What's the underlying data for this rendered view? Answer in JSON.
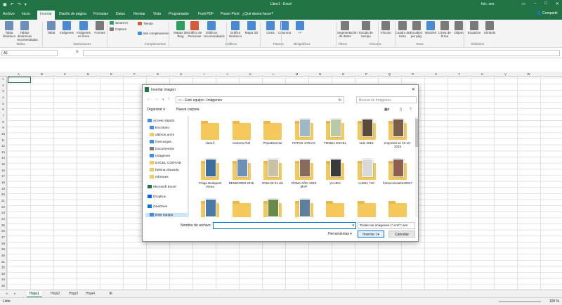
{
  "window": {
    "title": "Libro1  -  Excel",
    "user": "Inic. ses.",
    "share": "Compartir"
  },
  "quickaccess": [
    "save-icon",
    "undo-icon",
    "redo-icon",
    "customize-icon"
  ],
  "tabs": [
    "Archivo",
    "Inicio",
    "Insertar",
    "Diseño de página",
    "Fórmulas",
    "Datos",
    "Revisar",
    "Vista",
    "Programador",
    "Foxit PDF",
    "Power Pivot",
    "¿Qué desea hacer?"
  ],
  "ribbon": {
    "buttons": [
      {
        "label": "Tabla dinámica",
        "color": "#6b8fb8"
      },
      {
        "label": "Tablas dinámicas recomendadas",
        "color": "#6b8fb8"
      },
      {
        "label": "Tabla",
        "color": "#6b8fb8"
      },
      {
        "label": "Imágenes",
        "color": "#4a8ad4"
      },
      {
        "label": "Imágenes en línea",
        "color": "#4a8ad4"
      },
      {
        "label": "Formas",
        "color": "#7a7a7a"
      },
      {
        "label": "Mapas de Bing",
        "color": "#2e9e5b"
      },
      {
        "label": "Gráfico de Personas",
        "color": "#d65b3a"
      },
      {
        "label": "Gráficos recomendados",
        "color": "#4a8ad4"
      },
      {
        "label": "Gráfico dinámico",
        "color": "#4a8ad4"
      },
      {
        "label": "Mapa 3D",
        "color": "#4a8ad4"
      },
      {
        "label": "Línea",
        "color": "#4a8ad4"
      },
      {
        "label": "Columna",
        "color": "#4a8ad4"
      },
      {
        "label": "+/-",
        "color": "#4a8ad4"
      },
      {
        "label": "Segmentación de datos",
        "color": "#7a7a7a"
      },
      {
        "label": "Escala de tiempo",
        "color": "#7a7a7a"
      },
      {
        "label": "Vínculo",
        "color": "#7a7a7a"
      },
      {
        "label": "Cuadro de texto",
        "color": "#7a7a7a"
      },
      {
        "label": "Encabez. pie pág.",
        "color": "#7a7a7a"
      },
      {
        "label": "WordArt",
        "color": "#4a8ad4"
      },
      {
        "label": "Línea de firma",
        "color": "#7a7a7a"
      },
      {
        "label": "Objeto",
        "color": "#7a7a7a"
      },
      {
        "label": "Ecuación",
        "color": "#7a7a7a"
      },
      {
        "label": "Símbolo",
        "color": "#7a7a7a"
      }
    ],
    "small": [
      "SmartArt",
      "Captura",
      "Tienda",
      "Mis complementos"
    ],
    "groups": [
      "Tablas",
      "Ilustraciones",
      "Complementos",
      "Gráficos",
      "Paseos",
      "Minigráficos",
      "Filtros",
      "Vínculos",
      "Texto",
      "Símbolos"
    ]
  },
  "formula": {
    "namebox": "A1",
    "fx": "fx"
  },
  "columns": [
    "A",
    "B",
    "C",
    "D",
    "E",
    "F",
    "G",
    "H",
    "I",
    "J",
    "K",
    "L",
    "M",
    "N",
    "O",
    "P",
    "Q",
    "R",
    "S",
    "T",
    "U",
    "V",
    "W"
  ],
  "rows": [
    "1",
    "2",
    "3",
    "4",
    "5",
    "6",
    "7",
    "8",
    "9",
    "10",
    "11",
    "12",
    "13",
    "14",
    "15",
    "16",
    "17",
    "18",
    "19",
    "20",
    "21",
    "22",
    "23",
    "24",
    "25",
    "26",
    "27",
    "28",
    "29",
    "30",
    "31",
    "32",
    "33",
    "34",
    "35"
  ],
  "sheets": [
    "Hoja1",
    "Hoja2",
    "Hoja3",
    "Hoja4"
  ],
  "status": {
    "left": "Listo",
    "zoom": "100 %"
  },
  "dialog": {
    "title": "Insertar imagen",
    "path": [
      "Este equipo",
      "Imágenes"
    ],
    "search_placeholder": "Buscar en Imágenes",
    "organize": "Organizar ▾",
    "new_folder": "Nueva carpeta",
    "nav": [
      {
        "label": "Acceso rápido",
        "color": "#3c8ee6"
      },
      {
        "label": "Escritorio",
        "color": "#3c8ee6"
      },
      {
        "label": "ultimos archi",
        "color": "#f5c85b"
      },
      {
        "label": "Descargas",
        "color": "#3c8ee6"
      },
      {
        "label": "Documentos",
        "color": "#7a7a7a"
      },
      {
        "label": "Imágenes",
        "color": "#3c8ee6"
      },
      {
        "label": "EXCEL CONTAB",
        "color": "#f5c85b"
      },
      {
        "label": "helena clausula",
        "color": "#f5c85b"
      },
      {
        "label": "Informes",
        "color": "#f5c85b"
      },
      {
        "label": "Microsoft Excel",
        "color": "#217346"
      },
      {
        "label": "Dropbox",
        "color": "#0061fe"
      },
      {
        "label": "OneDrive",
        "color": "#0078d7"
      },
      {
        "label": "Este equipo",
        "color": "#3c8ee6"
      }
    ],
    "files": [
      {
        "name": "clear.fi",
        "type": "folder"
      },
      {
        "name": "Camera Roll",
        "type": "folder"
      },
      {
        "name": "PhotoDirector",
        "type": "folder"
      },
      {
        "name": "FOTOS VARIAS",
        "type": "photo",
        "color": "#9fb8c8"
      },
      {
        "name": "TIENDA EXCEL",
        "type": "photo",
        "color": "#b9c9a6"
      },
      {
        "name": "todo 2015",
        "type": "photo",
        "color": "#5a4a3a"
      },
      {
        "name": "Imported on 10-10-2015",
        "type": "photo",
        "color": "#7a5e48"
      },
      {
        "name": "Praga Budapest Viena",
        "type": "photo",
        "color": "#3a6e9e"
      },
      {
        "name": "BENIDORM 2015",
        "type": "photo",
        "color": "#6e8fb8"
      },
      {
        "name": "2016-03-31 dni",
        "type": "photo",
        "color": "#c9c0a8"
      },
      {
        "name": "ROMA AÑO 2016 MVP",
        "type": "photo",
        "color": "#8a6a5a"
      },
      {
        "name": "VIAJES",
        "type": "photo",
        "color": "#3a3a3a"
      },
      {
        "name": "LUMIA 710",
        "type": "photo",
        "color": "#d9d9d9"
      },
      {
        "name": "fotoscomida2442017",
        "type": "photo",
        "color": "#8e5e4e"
      },
      {
        "name": "",
        "type": "photo",
        "color": "#4a7aa8"
      },
      {
        "name": "",
        "type": "folder"
      },
      {
        "name": "",
        "type": "photo",
        "color": "#6a8a4a"
      },
      {
        "name": "",
        "type": "photo",
        "color": "#5e7e9e"
      },
      {
        "name": "",
        "type": "folder"
      },
      {
        "name": "",
        "type": "folder"
      },
      {
        "name": "",
        "type": "folder"
      }
    ],
    "filename_label": "Nombre de archivo:",
    "filename_value": "",
    "filetype": "Todas las imágenes (*.emf;*.wm",
    "tools": "Herramientas",
    "insert": "Insertar",
    "cancel": "Cancelar"
  }
}
